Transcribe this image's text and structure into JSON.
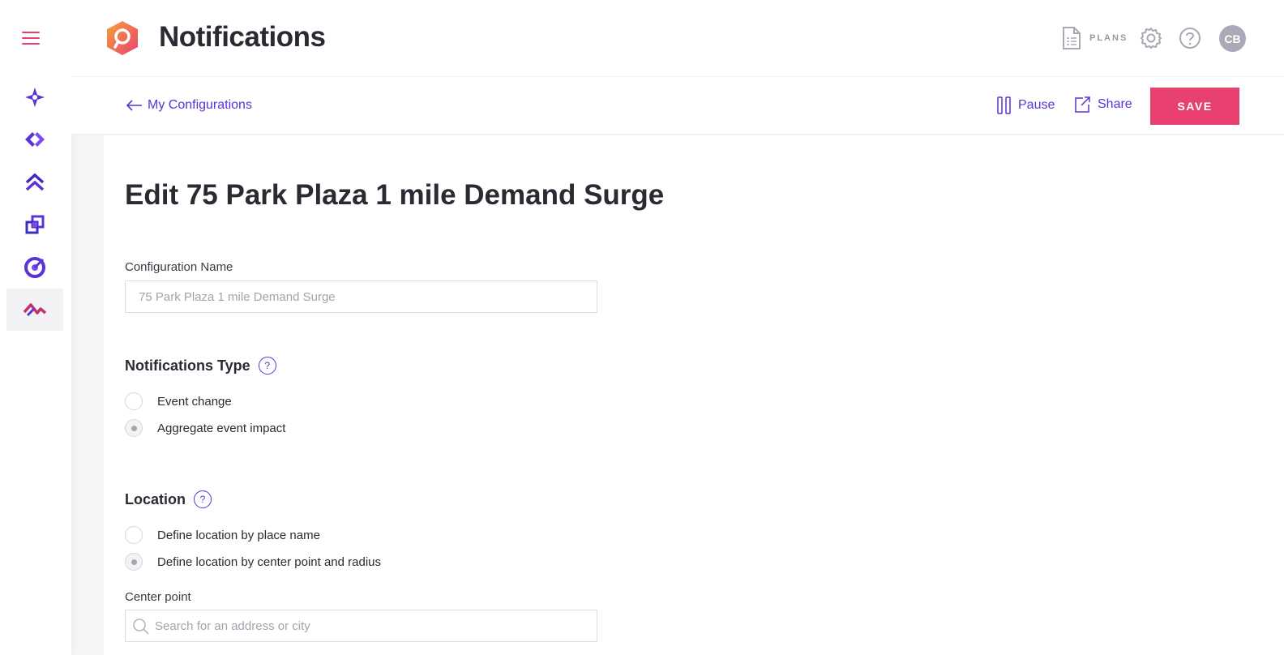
{
  "colors": {
    "accent": "#5b32d6",
    "brand_pink": "#e8416f"
  },
  "header": {
    "title": "Notifications",
    "plans_label": "PLANS",
    "avatar_initials": "CB"
  },
  "sidebar": {
    "items": [
      {
        "name": "sparkle-icon"
      },
      {
        "name": "diamond-arrows-icon"
      },
      {
        "name": "double-chevron-up-icon"
      },
      {
        "name": "overlap-squares-icon"
      },
      {
        "name": "target-icon"
      },
      {
        "name": "pulse-wave-icon",
        "active": true
      }
    ]
  },
  "toolbar": {
    "back_label": "My Configurations",
    "pause_label": "Pause",
    "share_label": "Share",
    "save_label": "SAVE"
  },
  "form": {
    "heading": "Edit 75 Park Plaza 1 mile Demand Surge",
    "config_name_label": "Configuration Name",
    "config_name_value": "75 Park Plaza 1 mile Demand Surge",
    "type_title": "Notifications Type",
    "type_options": [
      "Event change",
      "Aggregate event impact"
    ],
    "type_selected": 1,
    "location_title": "Location",
    "location_options": [
      "Define location by place name",
      "Define location by center point and radius"
    ],
    "location_selected": 1,
    "center_point_label": "Center point",
    "center_point_placeholder": "Search for an address or city",
    "help_glyph": "?"
  }
}
